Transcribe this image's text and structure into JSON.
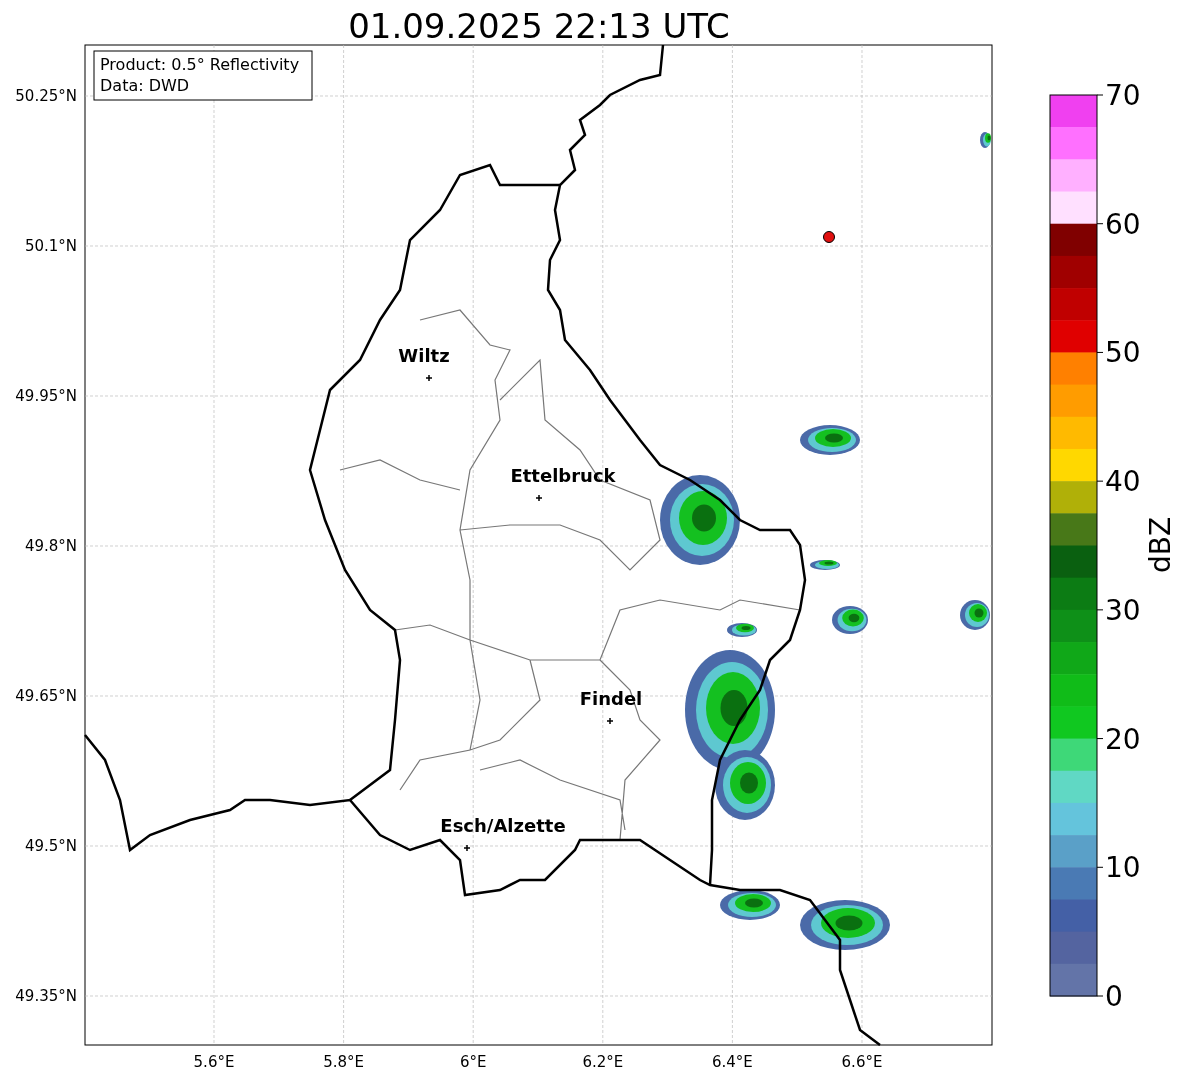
{
  "title": "01.09.2025 22:13 UTC",
  "info_box": [
    "Product: 0.5° Reflectivity",
    "Data: DWD"
  ],
  "lat_ticks": [
    "50.25°N",
    "50.1°N",
    "49.95°N",
    "49.8°N",
    "49.65°N",
    "49.5°N",
    "49.35°N"
  ],
  "lon_ticks": [
    "5.6°E",
    "5.8°E",
    "6°E",
    "6.2°E",
    "6.4°E",
    "6.6°E"
  ],
  "cities": [
    {
      "name": "Wiltz"
    },
    {
      "name": "Ettelbruck"
    },
    {
      "name": "Findel"
    },
    {
      "name": "Esch/Alzette"
    }
  ],
  "colorbar": {
    "segments": [
      {
        "color": "#f040f0"
      },
      {
        "color": "#ff70ff"
      },
      {
        "color": "#ffb0ff"
      },
      {
        "color": "#ffe0ff"
      },
      {
        "color": "#800000"
      },
      {
        "color": "#a00000"
      },
      {
        "color": "#c00000"
      },
      {
        "color": "#e00000"
      },
      {
        "color": "#ff8000"
      },
      {
        "color": "#ff9c00"
      },
      {
        "color": "#ffba00"
      },
      {
        "color": "#ffd800"
      },
      {
        "color": "#b0b008"
      },
      {
        "color": "#487818"
      },
      {
        "color": "#0a6010"
      },
      {
        "color": "#0c7c14"
      },
      {
        "color": "#0e9018"
      },
      {
        "color": "#10a818"
      },
      {
        "color": "#10bc18"
      },
      {
        "color": "#10c820"
      },
      {
        "color": "#3ed878"
      },
      {
        "color": "#60d8c4"
      },
      {
        "color": "#64c4dc"
      },
      {
        "color": "#5aa0c8"
      },
      {
        "color": "#4a7ab4"
      },
      {
        "color": "#4460a6"
      },
      {
        "color": "#5464a0"
      },
      {
        "color": "#6374a8"
      }
    ],
    "ticks": [
      "70",
      "60",
      "50",
      "40",
      "30",
      "20",
      "10",
      "0"
    ],
    "label": "dBZ"
  }
}
